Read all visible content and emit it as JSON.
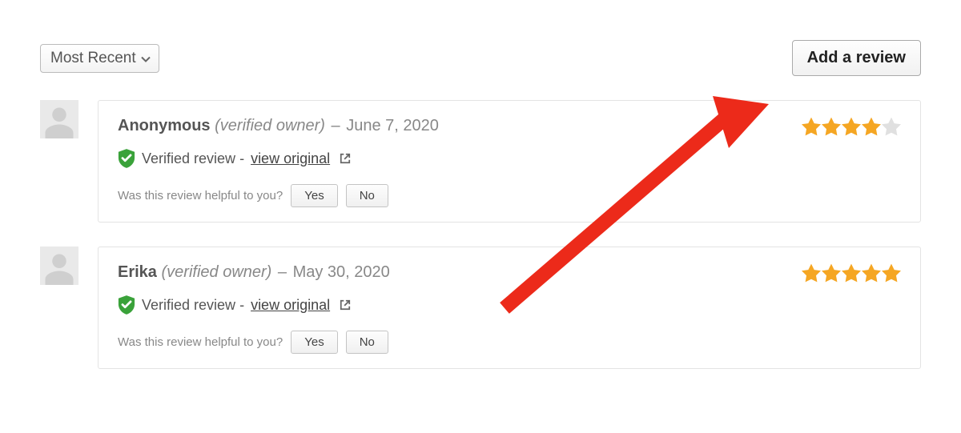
{
  "sort": {
    "selected": "Most Recent"
  },
  "actions": {
    "add_review": "Add a review"
  },
  "labels": {
    "verified_owner": "(verified owner)",
    "dash": "–",
    "verified_review": "Verified review",
    "view_original": "view original",
    "helpful_prompt": "Was this review helpful to you?",
    "yes": "Yes",
    "no": "No",
    "sep": " - "
  },
  "reviews": [
    {
      "author": "Anonymous",
      "date": "June 7, 2020",
      "rating": 4
    },
    {
      "author": "Erika",
      "date": "May 30, 2020",
      "rating": 5
    }
  ]
}
